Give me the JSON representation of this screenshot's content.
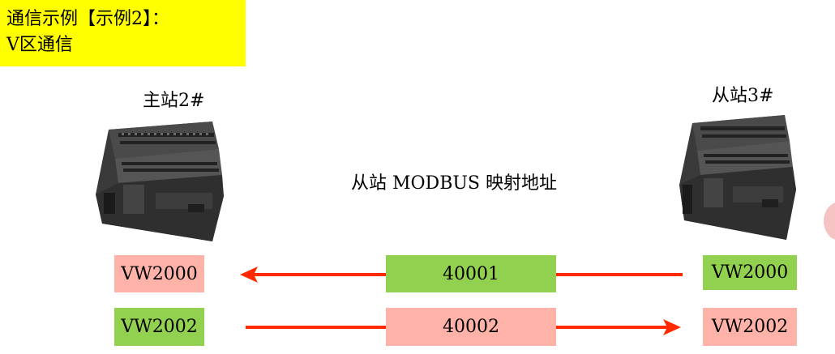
{
  "title": {
    "line1": "通信示例【示例2】：",
    "line2": "V区通信"
  },
  "master": {
    "label": "主站2#"
  },
  "slave": {
    "label": "从站3#"
  },
  "mapping_caption": "从站 MODBUS 映射地址",
  "rows": [
    {
      "master_value": "VW2000",
      "modbus_address": "40001",
      "slave_value": "VW2000",
      "direction": "slave-to-master"
    },
    {
      "master_value": "VW2002",
      "modbus_address": "40002",
      "slave_value": "VW2002",
      "direction": "master-to-slave"
    }
  ],
  "colors": {
    "title_bg": "#ffff00",
    "green": "#92d050",
    "pink": "#ffb3a8",
    "arrow": "#ff2a00"
  }
}
